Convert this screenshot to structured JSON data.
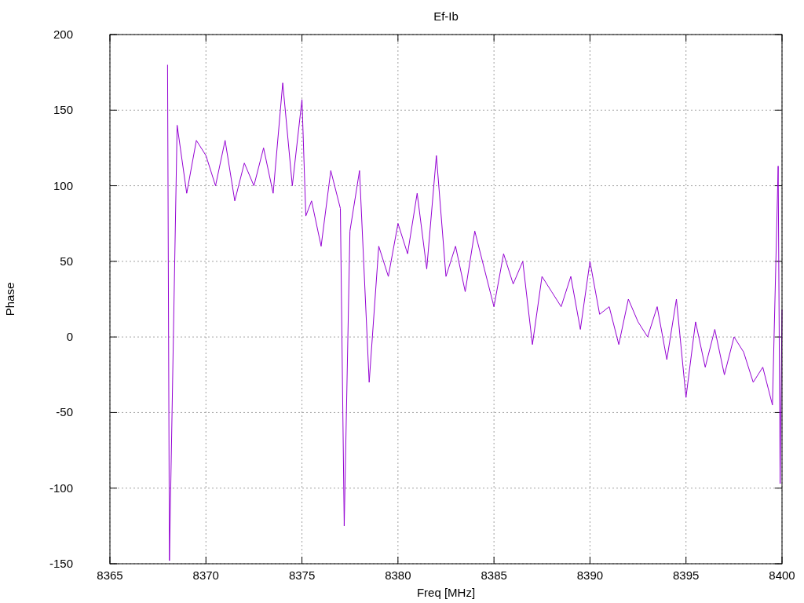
{
  "chart_data": {
    "type": "line",
    "grid": true,
    "title": "Ef-Ib",
    "xlabel": "Freq [MHz]",
    "ylabel": "Phase",
    "xlim": [
      8365,
      8400
    ],
    "ylim": [
      -150,
      200
    ],
    "xticks": [
      8365,
      8370,
      8375,
      8380,
      8385,
      8390,
      8395,
      8400
    ],
    "yticks": [
      -150,
      -100,
      -50,
      0,
      50,
      100,
      150,
      200
    ],
    "x": [
      8368,
      8368.1,
      8368.5,
      8369,
      8369.5,
      8370,
      8370.5,
      8371,
      8371.5,
      8372,
      8372.5,
      8373,
      8373.5,
      8374,
      8374.5,
      8375,
      8375.2,
      8375.5,
      8376,
      8376.5,
      8377,
      8377.2,
      8377.5,
      8378,
      8378.5,
      8379,
      8379.5,
      8380,
      8380.5,
      8381,
      8381.5,
      8382,
      8382.5,
      8383,
      8383.5,
      8384,
      8384.5,
      8385,
      8385.5,
      8386,
      8386.5,
      8387,
      8387.5,
      8388,
      8388.5,
      8389,
      8389.5,
      8390,
      8390.5,
      8391,
      8391.5,
      8392,
      8392.5,
      8393,
      8393.5,
      8394,
      8394.5,
      8395,
      8395.5,
      8396,
      8396.5,
      8397,
      8397.5,
      8398,
      8398.5,
      8399,
      8399.5,
      8399.8,
      8399.9,
      8400
    ],
    "series": [
      {
        "color": "#9400d3",
        "values": [
          180,
          -148,
          140,
          95,
          130,
          120,
          100,
          130,
          90,
          115,
          100,
          125,
          95,
          168,
          100,
          157,
          80,
          90,
          60,
          110,
          85,
          -125,
          70,
          110,
          -30,
          60,
          40,
          75,
          55,
          95,
          45,
          120,
          40,
          60,
          30,
          70,
          45,
          20,
          55,
          35,
          50,
          -5,
          40,
          30,
          20,
          40,
          5,
          50,
          15,
          20,
          -5,
          25,
          10,
          0,
          20,
          -15,
          25,
          -40,
          10,
          -20,
          5,
          -25,
          0,
          -10,
          -30,
          -20,
          -45,
          113,
          -97,
          18
        ]
      }
    ]
  }
}
